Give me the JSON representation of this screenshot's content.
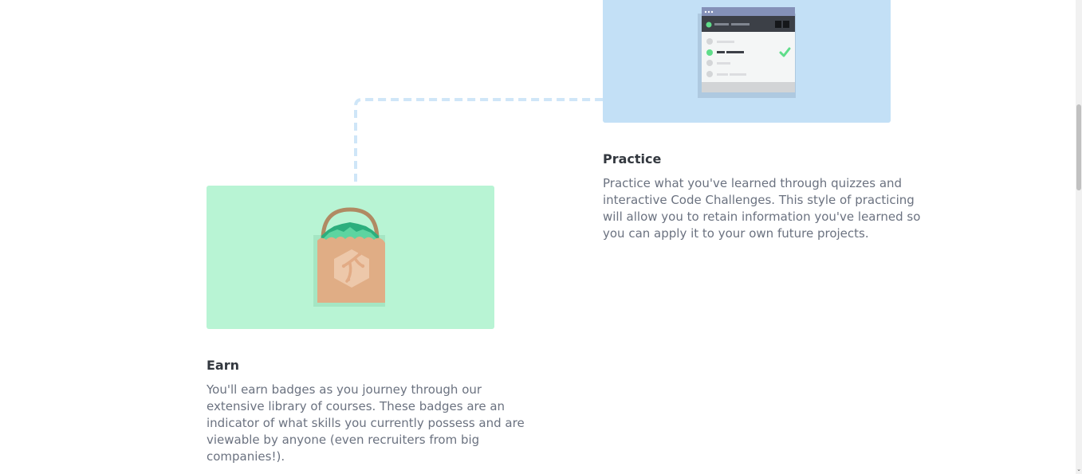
{
  "features": {
    "practice": {
      "title": "Practice",
      "description": "Practice what you've learned through quizzes and interactive Code Challenges. This style of practicing will allow you to retain information you've learned so you can apply it to your own future projects.",
      "art_bg": "#c3e0f6",
      "icon": "quiz-window-icon"
    },
    "earn": {
      "title": "Earn",
      "description": "You'll earn badges as you journey through our extensive library of courses. These badges are an indicator of what skills you currently possess and are viewable by anyone (even recruiters from big companies!).",
      "art_bg": "#b8f4d4",
      "icon": "badge-bag-icon"
    }
  },
  "colors": {
    "title_text": "#33383f",
    "body_text": "#6b7280",
    "connector": "#cfe6f8"
  },
  "scrollbar": {
    "arrow": "⌄"
  }
}
